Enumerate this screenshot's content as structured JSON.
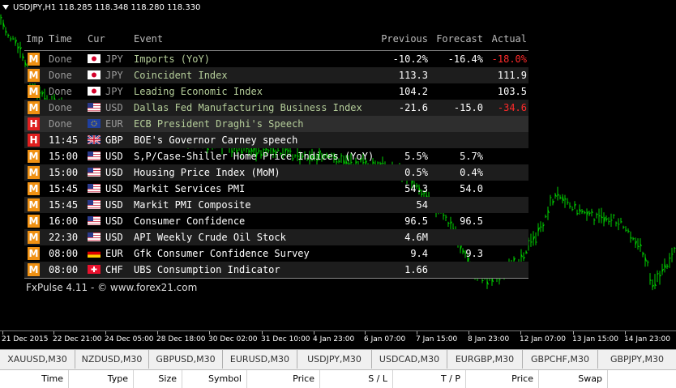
{
  "window": {
    "title": "USDJPY,H1  118.285 118.348 118.280 118.330"
  },
  "calendar": {
    "headers": {
      "imp": "Imp",
      "time": "Time",
      "cur": "Cur",
      "event": "Event",
      "previous": "Previous",
      "forecast": "Forecast",
      "actual": "Actual"
    },
    "colors": {
      "medium": "#f09113",
      "high": "#e01f1f",
      "negative_actual": "#ff2a2a",
      "done_text": "#9a9a9a",
      "done_event": "#b5ce9a",
      "upcoming_text": "#ffffff"
    },
    "rows": [
      {
        "imp": "M",
        "time": "Done",
        "cur": "JPY",
        "flag": "jp-flag-icon",
        "event": "Imports (YoY)",
        "previous": "-10.2%",
        "forecast": "-16.4%",
        "actual": "-18.0%",
        "actual_negative": true,
        "done": true
      },
      {
        "imp": "M",
        "time": "Done",
        "cur": "JPY",
        "flag": "jp-flag-icon",
        "event": "Coincident Index",
        "previous": "113.3",
        "forecast": "",
        "actual": "111.9",
        "actual_negative": false,
        "done": true
      },
      {
        "imp": "M",
        "time": "Done",
        "cur": "JPY",
        "flag": "jp-flag-icon",
        "event": "Leading Economic Index",
        "previous": "104.2",
        "forecast": "",
        "actual": "103.5",
        "actual_negative": false,
        "done": true
      },
      {
        "imp": "M",
        "time": "Done",
        "cur": "USD",
        "flag": "us-flag-icon",
        "event": "Dallas Fed Manufacturing Business Index",
        "previous": "-21.6",
        "forecast": "-15.0",
        "actual": "-34.6",
        "actual_negative": true,
        "done": true
      },
      {
        "imp": "H",
        "time": "Done",
        "cur": "EUR",
        "flag": "eu-flag-icon",
        "event": "ECB President Draghi's Speech",
        "previous": "",
        "forecast": "",
        "actual": "",
        "actual_negative": false,
        "done": true
      },
      {
        "imp": "H",
        "time": "11:45",
        "cur": "GBP",
        "flag": "gb-flag-icon",
        "event": "BOE's Governor Carney speech",
        "previous": "",
        "forecast": "",
        "actual": "",
        "actual_negative": false,
        "done": false
      },
      {
        "imp": "M",
        "time": "15:00",
        "cur": "USD",
        "flag": "us-flag-icon",
        "event": "S,P/Case-Shiller Home Price Indices (YoY)",
        "previous": "5.5%",
        "forecast": "5.7%",
        "actual": "",
        "actual_negative": false,
        "done": false
      },
      {
        "imp": "M",
        "time": "15:00",
        "cur": "USD",
        "flag": "us-flag-icon",
        "event": "Housing Price Index (MoM)",
        "previous": "0.5%",
        "forecast": "0.4%",
        "actual": "",
        "actual_negative": false,
        "done": false
      },
      {
        "imp": "M",
        "time": "15:45",
        "cur": "USD",
        "flag": "us-flag-icon",
        "event": "Markit Services PMI",
        "previous": "54.3",
        "forecast": "54.0",
        "actual": "",
        "actual_negative": false,
        "done": false
      },
      {
        "imp": "M",
        "time": "15:45",
        "cur": "USD",
        "flag": "us-flag-icon",
        "event": "Markit PMI Composite",
        "previous": "54",
        "forecast": "",
        "actual": "",
        "actual_negative": false,
        "done": false
      },
      {
        "imp": "M",
        "time": "16:00",
        "cur": "USD",
        "flag": "us-flag-icon",
        "event": "Consumer Confidence",
        "previous": "96.5",
        "forecast": "96.5",
        "actual": "",
        "actual_negative": false,
        "done": false
      },
      {
        "imp": "M",
        "time": "22:30",
        "cur": "USD",
        "flag": "us-flag-icon",
        "event": "API Weekly Crude Oil Stock",
        "previous": "4.6M",
        "forecast": "",
        "actual": "",
        "actual_negative": false,
        "done": false
      },
      {
        "imp": "M",
        "time": "08:00",
        "cur": "EUR",
        "flag": "de-flag-icon",
        "event": "Gfk Consumer Confidence Survey",
        "previous": "9.4",
        "forecast": "9.3",
        "actual": "",
        "actual_negative": false,
        "done": false
      },
      {
        "imp": "M",
        "time": "08:00",
        "cur": "CHF",
        "flag": "ch-flag-icon",
        "event": "UBS Consumption Indicator",
        "previous": "1.66",
        "forecast": "",
        "actual": "",
        "actual_negative": false,
        "done": false
      }
    ],
    "footer": "FxPulse 4.11 - © www.forex21.com"
  },
  "time_axis": [
    "21 Dec 2015",
    "22 Dec 21:00",
    "24 Dec 05:00",
    "28 Dec 18:00",
    "30 Dec 02:00",
    "31 Dec 10:00",
    "4 Jan 23:00",
    "6 Jan 07:00",
    "7 Jan 15:00",
    "8 Jan 23:00",
    "12 Jan 07:00",
    "13 Jan 15:00",
    "14 Jan 23:00"
  ],
  "symbol_tabs": [
    "XAUUSD,M30",
    "NZDUSD,M30",
    "GBPUSD,M30",
    "EURUSD,M30",
    "USDJPY,M30",
    "USDCAD,M30",
    "EURGBP,M30",
    "GBPCHF,M30",
    "GBPJPY,M30"
  ],
  "terminal_columns": [
    "Time",
    "Type",
    "Size",
    "Symbol",
    "Price",
    "S / L",
    "T / P",
    "Price",
    "Swap"
  ],
  "chart_colors": {
    "bars": "#00d000",
    "background": "#000000"
  }
}
